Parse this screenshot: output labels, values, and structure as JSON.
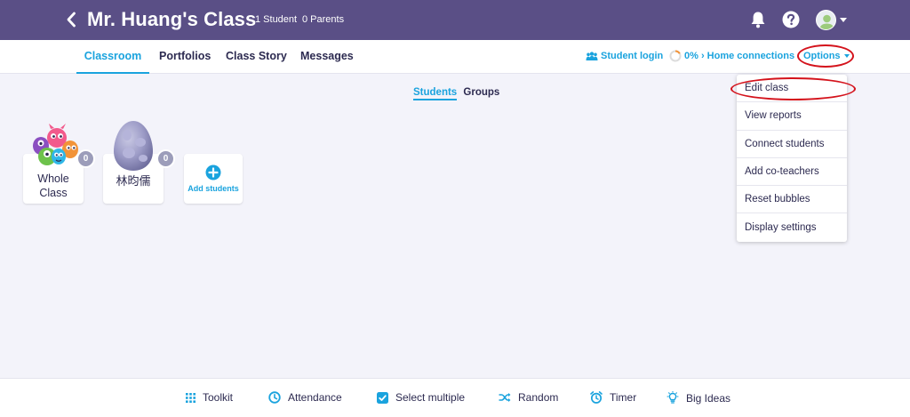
{
  "header": {
    "class_title": "Mr. Huang's Class",
    "students_count": "1 Student",
    "parents_count": "0 Parents"
  },
  "nav": {
    "tabs": [
      {
        "label": "Classroom",
        "active": true
      },
      {
        "label": "Portfolios",
        "active": false
      },
      {
        "label": "Class Story",
        "active": false
      },
      {
        "label": "Messages",
        "active": false
      }
    ],
    "student_login": "Student login",
    "home_connections": "0% › Home connections",
    "options": "Options"
  },
  "view_toggle": {
    "students": "Students",
    "groups": "Groups",
    "active": "Students"
  },
  "cards": {
    "whole_class": {
      "line1": "Whole",
      "line2": "Class",
      "points": "0"
    },
    "student": {
      "name": "林昀儒",
      "points": "0"
    },
    "add_students": "Add students"
  },
  "options_menu": {
    "items": [
      "Edit class",
      "View reports",
      "Connect students",
      "Add co-teachers",
      "Reset bubbles",
      "Display settings"
    ]
  },
  "toolbar": {
    "toolkit": "Toolkit",
    "attendance": "Attendance",
    "select_multiple": "Select multiple",
    "random": "Random",
    "timer": "Timer",
    "big_ideas": "Big Ideas"
  },
  "colors": {
    "header_bg": "#5a4f86",
    "accent": "#1aa3de",
    "annotation_red": "#d4121b",
    "badge": "#9c9dba"
  }
}
